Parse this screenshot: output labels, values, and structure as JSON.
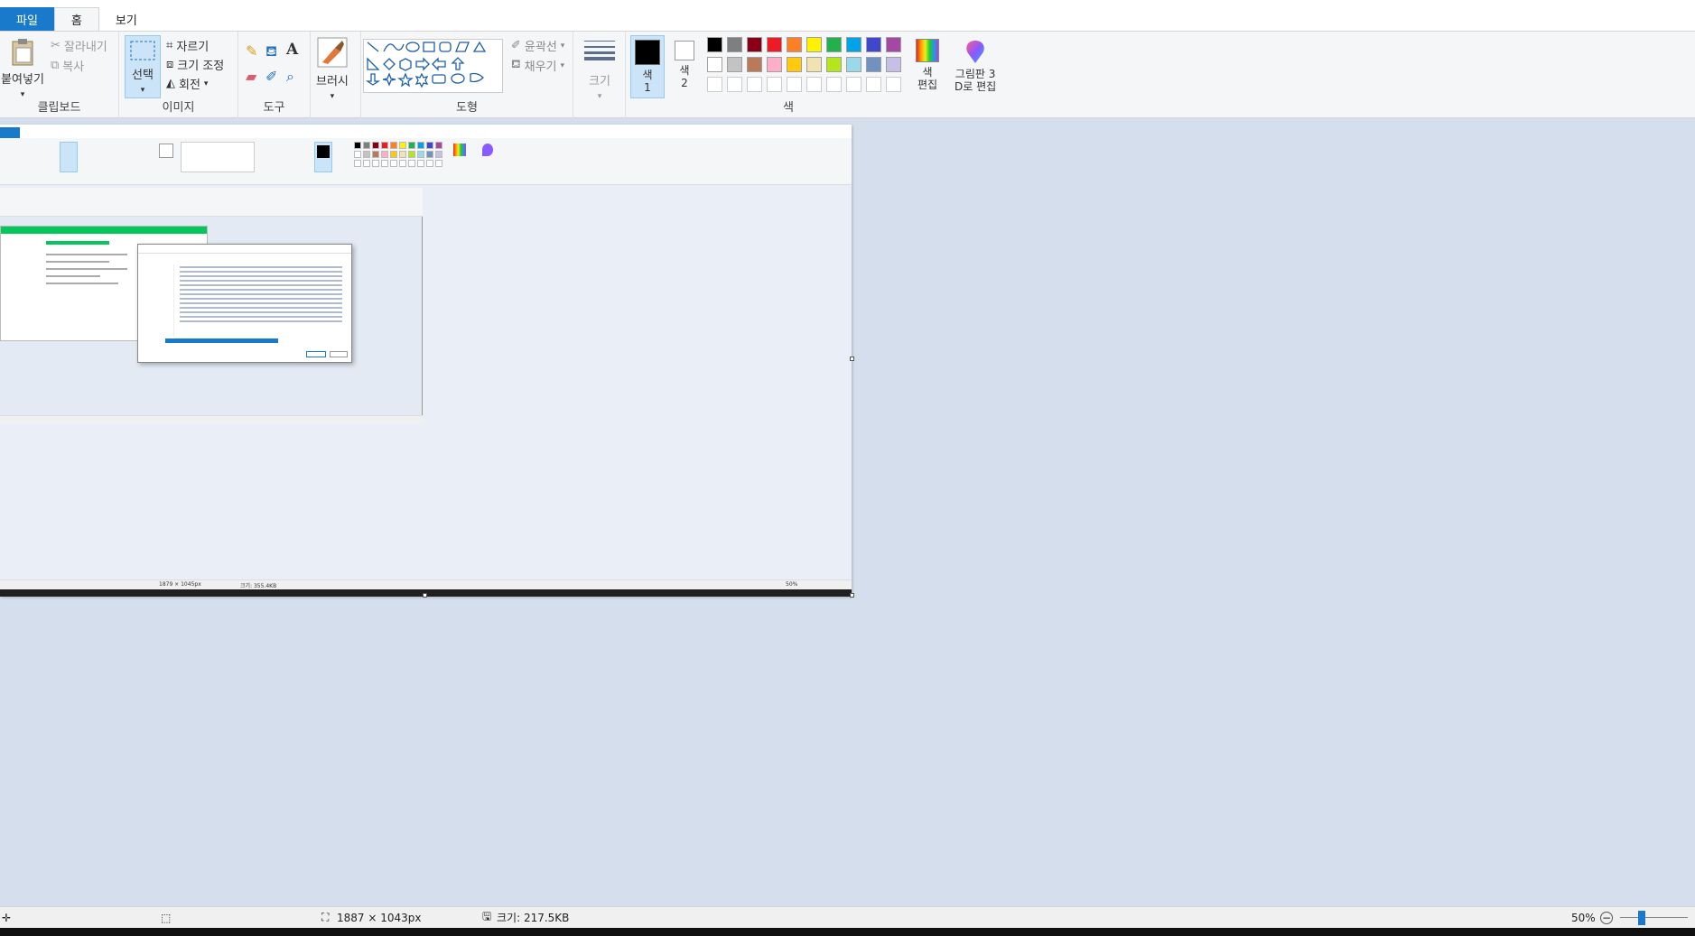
{
  "ribbon_tabs": [
    "파일",
    "홈",
    "보기"
  ],
  "clipboard": {
    "paste": "붙여넣기",
    "cut": "잘라내기",
    "copy": "복사",
    "label": "클립보드"
  },
  "image": {
    "select": "선택",
    "crop": "자르기",
    "resize": "크기 조정",
    "rotate": "회전",
    "label": "이미지"
  },
  "tools": {
    "label": "도구"
  },
  "brushes": {
    "label": "브러시"
  },
  "shapes": {
    "outline": "윤곽선",
    "fill": "채우기",
    "label": "도형"
  },
  "size": {
    "label": "크기"
  },
  "colors": {
    "color1": "색\n1",
    "color2": "색\n2",
    "edit": "색\n편집",
    "label": "색",
    "palette_row1": [
      "#000000",
      "#7f7f7f",
      "#880015",
      "#ed1c24",
      "#ff7f27",
      "#fff200",
      "#22b14c",
      "#00a2e8",
      "#3f48cc",
      "#a349a4"
    ],
    "palette_row2": [
      "#ffffff",
      "#c3c3c3",
      "#b97a57",
      "#ffaec9",
      "#ffc90e",
      "#efe4b0",
      "#b5e61d",
      "#99d9ea",
      "#7092be",
      "#c8bfe7"
    ]
  },
  "paint3d": {
    "label": "그림판 3\nD로 편집"
  },
  "status": {
    "dimensions": "1887 × 1043px",
    "filesize": "크기: 217.5KB",
    "zoom": "50%"
  },
  "nested": {
    "dimensions": "1879 × 1045px",
    "filesize": "크기: 355.4KB",
    "zoom": "50%"
  }
}
